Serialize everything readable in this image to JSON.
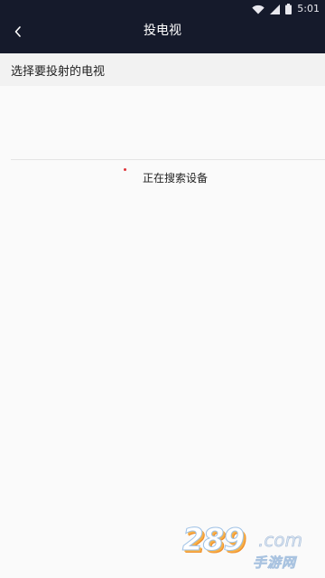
{
  "status_bar": {
    "time": "5:01",
    "icons": [
      "wifi-icon",
      "signal-icon",
      "battery-icon"
    ]
  },
  "header": {
    "title": "投电视",
    "back_icon": "chevron-left-icon"
  },
  "section": {
    "title": "选择要投射的电视"
  },
  "search": {
    "status_text": "正在搜索设备",
    "spinner_color": "#e0343a"
  },
  "watermark": {
    "brand": "289",
    "domain": ".com",
    "subtitle": "手游网"
  },
  "colors": {
    "header_bg": "#151a2b",
    "page_bg": "#fafafa",
    "section_bg": "#f2f2f2"
  }
}
